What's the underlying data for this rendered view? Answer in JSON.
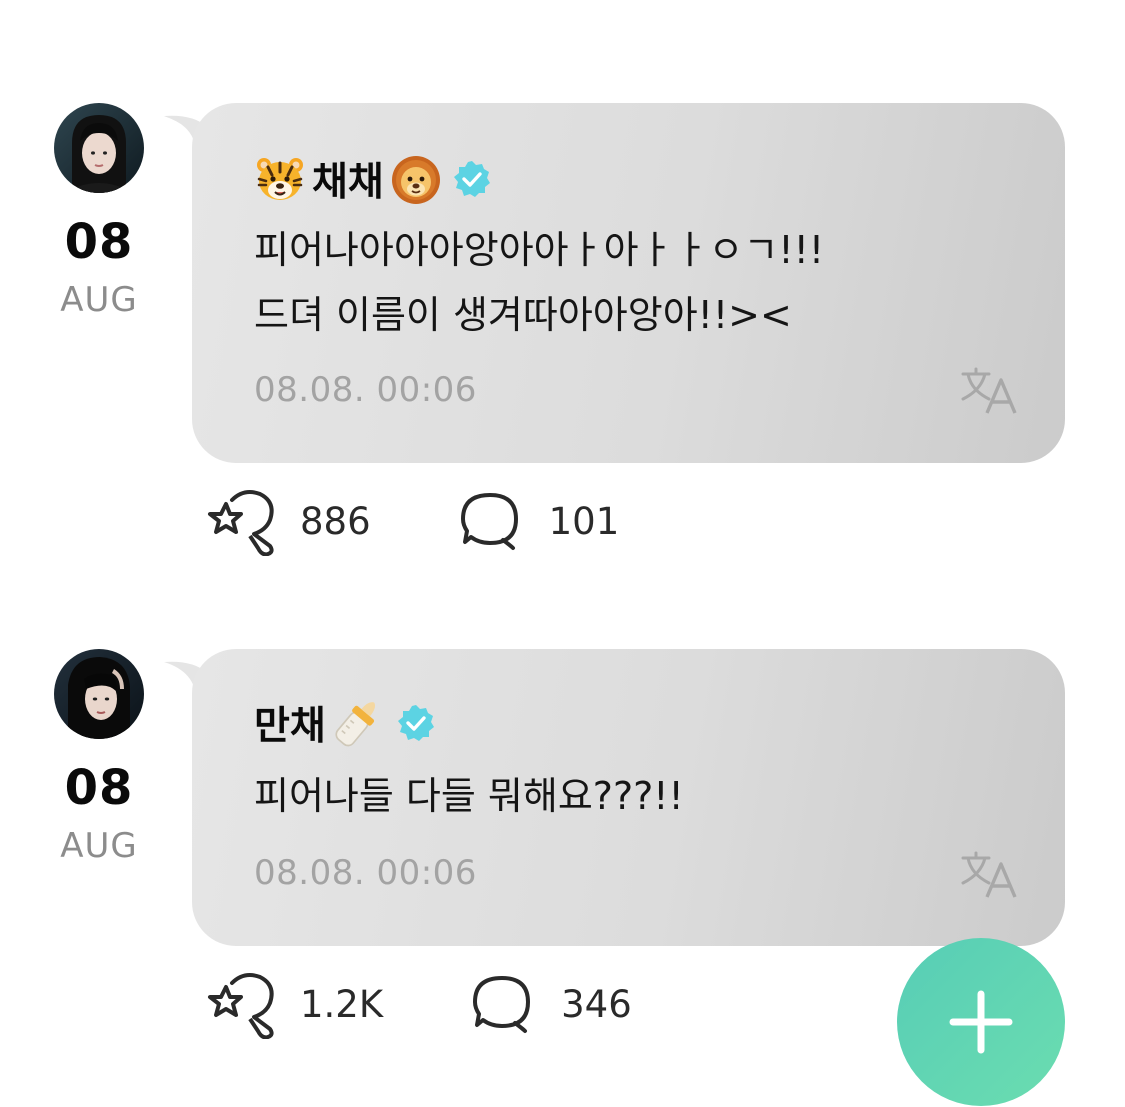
{
  "posts": [
    {
      "day": "08",
      "month": "AUG",
      "author": "채채",
      "author_prefix_emoji": "tiger-face-emoji",
      "author_suffix_emoji": "lion-face-emoji",
      "lines": [
        "피어나아아아앙아아ㅏ아ㅏㅏㅇㄱ!!!",
        "드뎌 이름이 생겨따아아앙아!!><"
      ],
      "timestamp": "08.08. 00:06",
      "likes": "886",
      "comments": "101"
    },
    {
      "day": "08",
      "month": "AUG",
      "author": "만채",
      "author_suffix_emoji": "baby-bottle-emoji",
      "lines": [
        "피어나들 다들 뭐해요???!!"
      ],
      "timestamp": "08.08. 00:06",
      "likes": "1.2K",
      "comments": "346"
    }
  ],
  "colors": {
    "bubble": "#dcdcdc",
    "verified": "#5cd3e3",
    "fab": "#5fd6b4",
    "timestamp": "#a3a3a3"
  },
  "icons": {
    "verified": "verified-badge-icon",
    "translate": "translate-icon",
    "like": "star-heart-icon",
    "comment": "speech-bubble-icon",
    "compose": "plus-icon"
  }
}
